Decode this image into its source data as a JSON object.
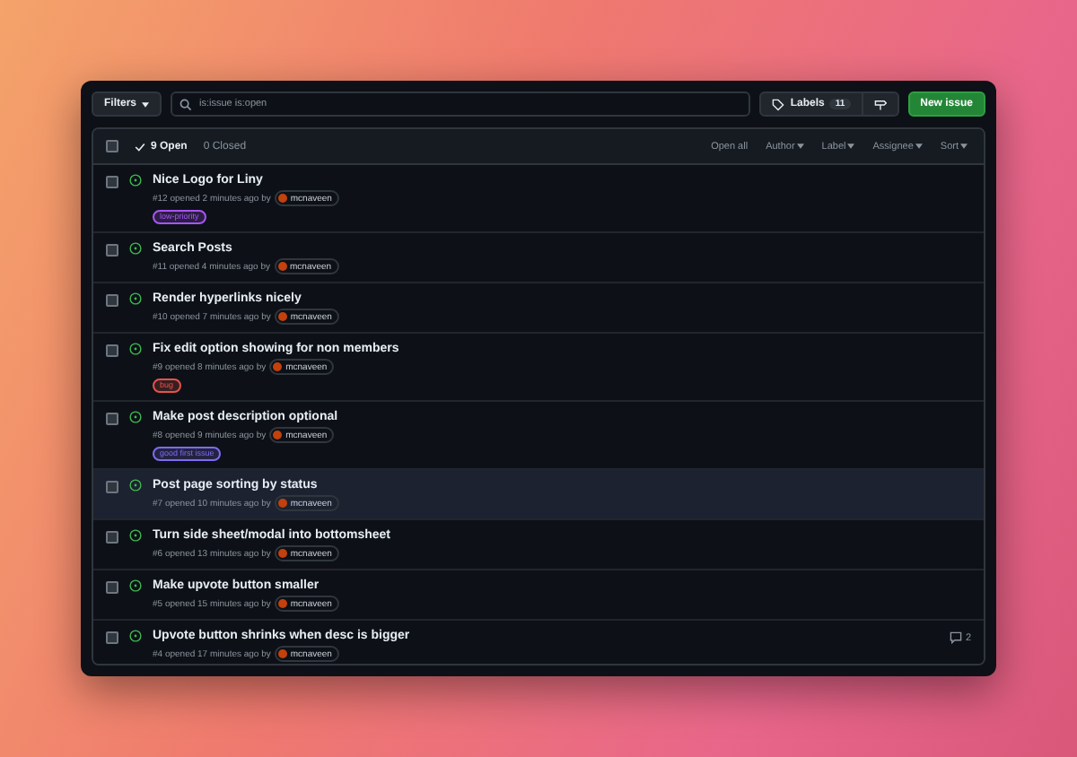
{
  "toolbar": {
    "filters_button": "Filters",
    "search": {
      "value": "is:issue is:open"
    },
    "labels_button": {
      "label": "Labels",
      "count": "11"
    },
    "new_issue_button": "New issue"
  },
  "list_header": {
    "select_all_checked": false,
    "open_tab": {
      "label": "9 Open",
      "selected": true
    },
    "closed_tab": {
      "label": "0 Closed",
      "selected": false
    },
    "actions": [
      {
        "label": "Open all",
        "dropdown": false
      },
      {
        "label": "Author",
        "dropdown": true
      },
      {
        "label": "Label",
        "dropdown": true
      },
      {
        "label": "Assignee",
        "dropdown": true
      },
      {
        "label": "Sort",
        "dropdown": true
      }
    ]
  },
  "issues": [
    {
      "title": "Nice Logo for Liny",
      "number": "#12",
      "opened": "opened 2 minutes ago by",
      "author": "mcnaveen",
      "labels": [
        {
          "name": "low-priority",
          "color": "#a855f7"
        }
      ],
      "checked": false,
      "highlighted": false
    },
    {
      "title": "Search Posts",
      "number": "#11",
      "opened": "opened 4 minutes ago by",
      "author": "mcnaveen",
      "checked": false,
      "highlighted": false
    },
    {
      "title": "Render hyperlinks nicely",
      "number": "#10",
      "opened": "opened 7 minutes ago by",
      "author": "mcnaveen",
      "checked": false,
      "highlighted": false
    },
    {
      "title": "Fix edit option showing for non members",
      "number": "#9",
      "opened": "opened 8 minutes ago by",
      "author": "mcnaveen",
      "labels": [
        {
          "name": "bug",
          "color": "#e5534b"
        }
      ],
      "checked": false,
      "highlighted": false
    },
    {
      "title": "Make post description optional",
      "number": "#8",
      "opened": "opened 9 minutes ago by",
      "author": "mcnaveen",
      "labels": [
        {
          "name": "good first issue",
          "color": "#7c6cf0"
        }
      ],
      "checked": false,
      "highlighted": false
    },
    {
      "title": "Post page sorting by status",
      "number": "#7",
      "opened": "opened 10 minutes ago by",
      "author": "mcnaveen",
      "checked": false,
      "highlighted": true
    },
    {
      "title": "Turn side sheet/modal into bottomsheet",
      "number": "#6",
      "opened": "opened 13 minutes ago by",
      "author": "mcnaveen",
      "checked": false,
      "highlighted": false
    },
    {
      "title": "Make upvote button smaller",
      "number": "#5",
      "opened": "opened 15 minutes ago by",
      "author": "mcnaveen",
      "checked": false,
      "highlighted": false
    },
    {
      "title": "Upvote button shrinks when desc is bigger",
      "number": "#4",
      "opened": "opened 17 minutes ago by",
      "author": "mcnaveen",
      "checked": false,
      "highlighted": false,
      "comments": "2"
    }
  ]
}
